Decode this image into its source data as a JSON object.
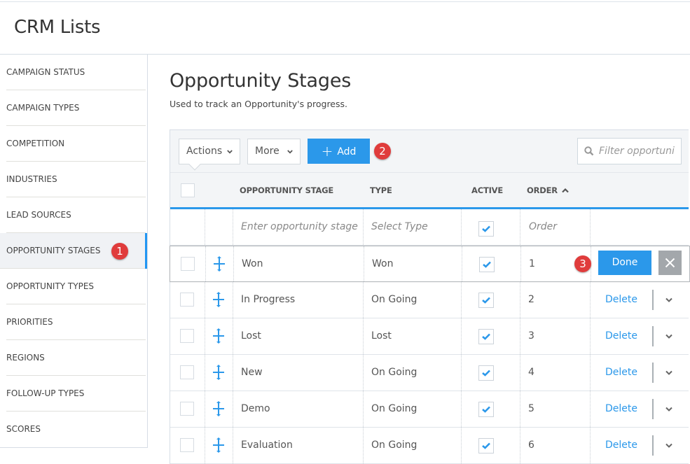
{
  "app": {
    "title": "CRM Lists"
  },
  "sidebar": {
    "items": [
      {
        "label": "CAMPAIGN STATUS",
        "active": false
      },
      {
        "label": "CAMPAIGN TYPES",
        "active": false
      },
      {
        "label": "COMPETITION",
        "active": false
      },
      {
        "label": "INDUSTRIES",
        "active": false
      },
      {
        "label": "LEAD SOURCES",
        "active": false
      },
      {
        "label": "OPPORTUNITY STAGES",
        "active": true
      },
      {
        "label": "OPPORTUNITY TYPES",
        "active": false
      },
      {
        "label": "PRIORITIES",
        "active": false
      },
      {
        "label": "REGIONS",
        "active": false
      },
      {
        "label": "FOLLOW-UP TYPES",
        "active": false
      },
      {
        "label": "SCORES",
        "active": false
      }
    ]
  },
  "callouts": {
    "one": "1",
    "two": "2",
    "three": "3"
  },
  "main": {
    "title": "Opportunity Stages",
    "subtitle": "Used to track an Opportunity's progress."
  },
  "toolbar": {
    "actions_label": "Actions",
    "more_label": "More",
    "add_label": "Add",
    "add_icon": "+",
    "filter_placeholder": "Filter opportuni"
  },
  "table": {
    "columns": {
      "stage": "OPPORTUNITY STAGE",
      "type": "TYPE",
      "active": "ACTIVE",
      "order": "ORDER"
    },
    "sort": {
      "column": "order",
      "direction": "ascending"
    },
    "new_row": {
      "stage_placeholder": "Enter opportunity stage",
      "type_placeholder": "Select Type",
      "active": true,
      "order_placeholder": "Order"
    },
    "edit_row": {
      "stage": "Won",
      "type": "Won",
      "active": true,
      "order": "1",
      "done_label": "Done"
    },
    "rows": [
      {
        "stage": "In Progress",
        "type": "On Going",
        "active": true,
        "order": "2",
        "delete_label": "Delete"
      },
      {
        "stage": "Lost",
        "type": "Lost",
        "active": true,
        "order": "3",
        "delete_label": "Delete"
      },
      {
        "stage": "New",
        "type": "On Going",
        "active": true,
        "order": "4",
        "delete_label": "Delete"
      },
      {
        "stage": "Demo",
        "type": "On Going",
        "active": true,
        "order": "5",
        "delete_label": "Delete"
      },
      {
        "stage": "Evaluation",
        "type": "On Going",
        "active": true,
        "order": "6",
        "delete_label": "Delete"
      }
    ]
  },
  "colors": {
    "accent": "#2b98ea",
    "callout": "#e03c3c",
    "cancel": "#a3a7ab"
  }
}
